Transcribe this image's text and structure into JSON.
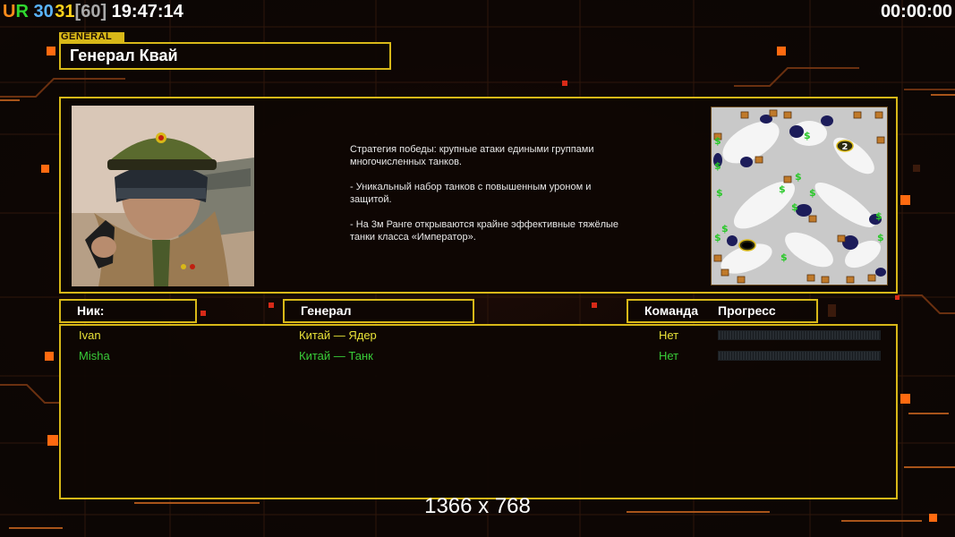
{
  "osd": {
    "ur": "UR",
    "v1": "30",
    "v2": "31",
    "v3": "[60]",
    "time": "19:47:14",
    "timer": "00:00:00",
    "colors": {
      "ur_u": "#ff8c1a",
      "ur_r": "#2fd82f",
      "v1": "#5ab4ff",
      "v2": "#ffd21a",
      "v3": "#a9a9a9"
    }
  },
  "general": {
    "tag": "GENERAL",
    "name": "Генерал Квай",
    "portrait_icon": "general-portrait",
    "description": [
      "Стратегия победы: крупные атаки едиными группами многочисленных танков.",
      "- Уникальный набор танков с повышенным уроном и защитой.",
      "- На 3м Ранге открываются крайне эффективные тяжёлые танки класса «Император»."
    ]
  },
  "minimap": {
    "start_marker": "2",
    "icons": [
      "supply-dock-icon",
      "oil-derrick-icon",
      "start-position-icon"
    ]
  },
  "table": {
    "headers": {
      "nick": "Ник:",
      "general": "Генерал",
      "team": "Команда",
      "progress": "Прогресс"
    },
    "players": [
      {
        "nick": "Ivan",
        "general": "Китай — Ядер",
        "team": "Нет",
        "progress": 0,
        "color": "#e8e238"
      },
      {
        "nick": "Misha",
        "general": "Китай — Танк",
        "team": "Нет",
        "progress": 0,
        "color": "#38cc38"
      }
    ]
  },
  "resolution": "1366 x 768",
  "colors": {
    "frame": "#d8b818",
    "accent": "#ff6a10",
    "background": "#0d0604"
  }
}
